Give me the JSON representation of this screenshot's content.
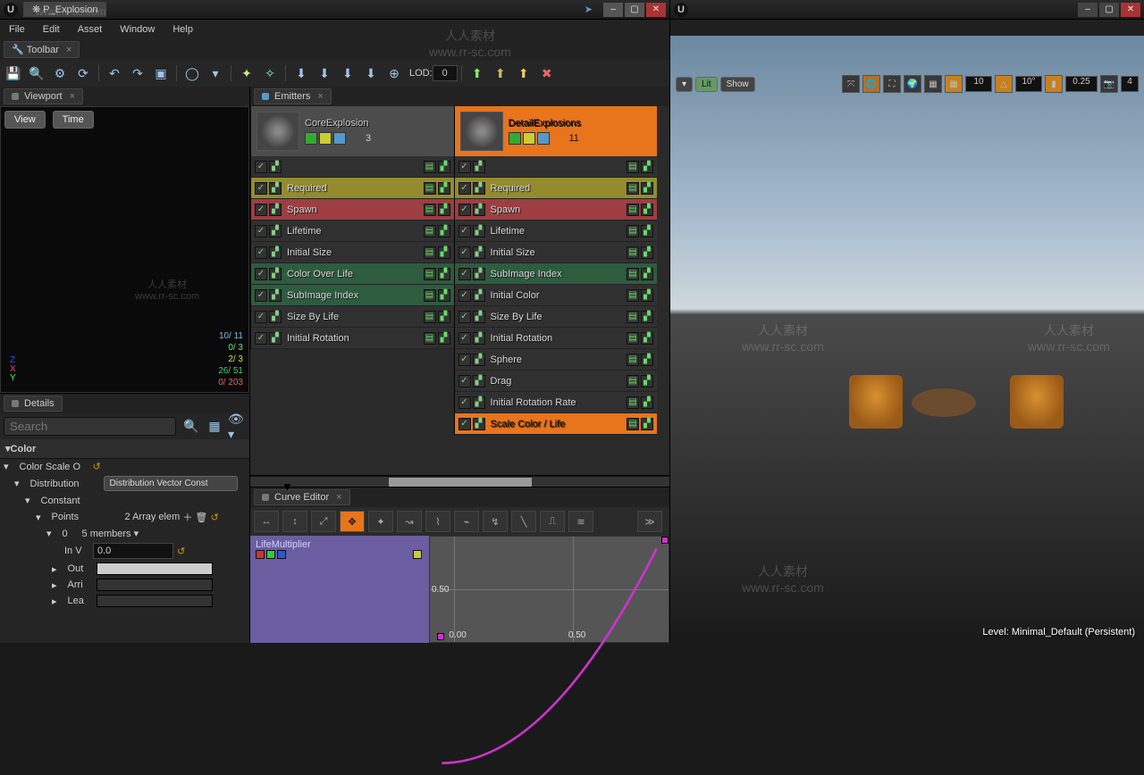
{
  "titlebar": {
    "tab": "P_Explosion"
  },
  "menu": {
    "file": "File",
    "edit": "Edit",
    "asset": "Asset",
    "window": "Window",
    "help": "Help"
  },
  "toolbar": {
    "label": "Toolbar",
    "lod": "LOD:",
    "lod_val": "0"
  },
  "viewport": {
    "label": "Viewport",
    "view": "View",
    "time": "Time",
    "stats": [
      "10/ 11",
      "0/ 3",
      "2/ 3",
      "26/ 51",
      "0/ 203"
    ],
    "axes": {
      "z": "Z",
      "x": "X",
      "y": "Y"
    }
  },
  "details": {
    "label": "Details",
    "search_ph": "Search",
    "color": "Color",
    "color_scale": "Color Scale O",
    "dist": "Distribution",
    "dist_val": "Distribution Vector Const",
    "const": "Constant",
    "points": "Points",
    "points_val": "2 Array elem",
    "idx": "0",
    "idx_val": "5 members",
    "inv": "In V",
    "inv_val": "0.0",
    "out": "Out",
    "arri": "Arri",
    "lea": "Lea"
  },
  "emitters": {
    "label": "Emitters",
    "cols": [
      {
        "name": "CoreExplosion",
        "count": "3",
        "headClass": "core",
        "mods": [
          {
            "t": "",
            "c": "blank"
          },
          {
            "t": "Required",
            "c": "yellow"
          },
          {
            "t": "Spawn",
            "c": "red"
          },
          {
            "t": "Lifetime",
            "c": "blank"
          },
          {
            "t": "Initial Size",
            "c": "blank"
          },
          {
            "t": "Color Over Life",
            "c": "green"
          },
          {
            "t": "SubImage Index",
            "c": "green"
          },
          {
            "t": "Size By Life",
            "c": "blank"
          },
          {
            "t": "Initial Rotation",
            "c": "blank"
          }
        ]
      },
      {
        "name": "DetailExplosions",
        "count": "11",
        "headClass": "detail",
        "mods": [
          {
            "t": "",
            "c": "blank"
          },
          {
            "t": "Required",
            "c": "yellow"
          },
          {
            "t": "Spawn",
            "c": "red"
          },
          {
            "t": "Lifetime",
            "c": "blank"
          },
          {
            "t": "Initial Size",
            "c": "blank"
          },
          {
            "t": "SubImage Index",
            "c": "green"
          },
          {
            "t": "Initial Color",
            "c": "blank"
          },
          {
            "t": "Size By Life",
            "c": "blank"
          },
          {
            "t": "Initial Rotation",
            "c": "blank"
          },
          {
            "t": "Sphere",
            "c": "blank"
          },
          {
            "t": "Drag",
            "c": "blank"
          },
          {
            "t": "Initial Rotation Rate",
            "c": "blank"
          },
          {
            "t": "Scale Color / Life",
            "c": "orange"
          }
        ]
      }
    ]
  },
  "curve": {
    "label": "Curve Editor",
    "track": "LifeMultiplier",
    "ytick": "0.50",
    "xt1": "0.00",
    "xt2": "0.50"
  },
  "rightvp": {
    "lit": "Lit",
    "show": "Show",
    "nums": {
      "a": "10",
      "b": "10",
      "c": "10°",
      "d": "0.25",
      "e": "4"
    },
    "level": "Level:  Minimal_Default (Persistent)"
  },
  "watermark": {
    "cn": "人人素材",
    "url": "www.rr-sc.com"
  }
}
